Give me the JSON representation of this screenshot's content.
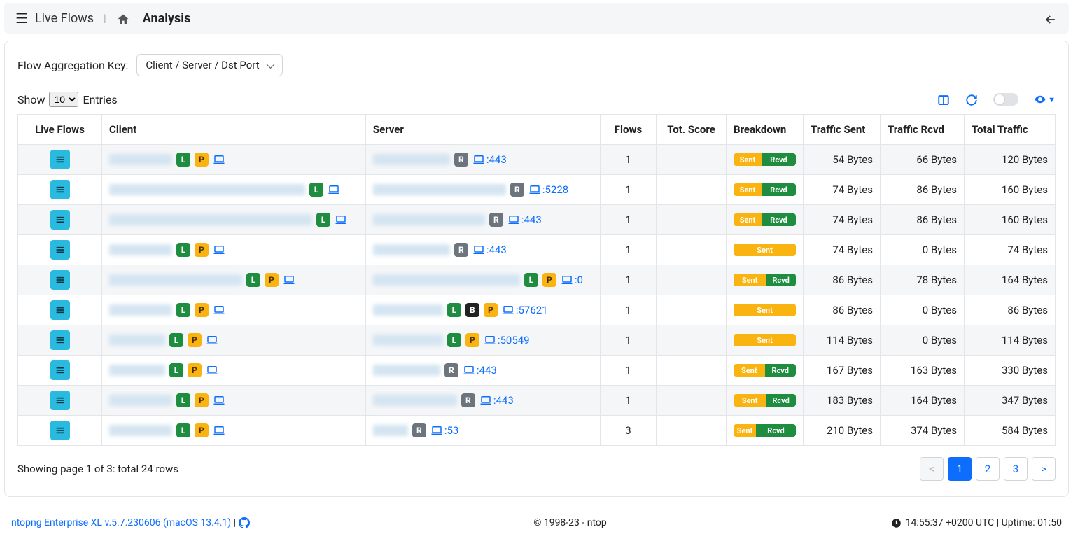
{
  "header": {
    "page_title": "Live Flows",
    "current_section": "Analysis"
  },
  "filter": {
    "label": "Flow Aggregation Key:",
    "selected": "Client / Server / Dst Port"
  },
  "table_controls": {
    "show_label": "Show",
    "entries_label": "Entries",
    "page_size": "10"
  },
  "columns": {
    "live": "Live Flows",
    "client": "Client",
    "server": "Server",
    "flows": "Flows",
    "score": "Tot. Score",
    "breakdown": "Breakdown",
    "sent": "Traffic Sent",
    "rcvd": "Traffic Rcvd",
    "total": "Total Traffic"
  },
  "breakdown_labels": {
    "sent": "Sent",
    "rcvd": "Rcvd"
  },
  "rows": [
    {
      "client_w": 90,
      "client_badges": [
        "L",
        "P"
      ],
      "server_w": 110,
      "server_badges": [
        "R"
      ],
      "port": "443",
      "flows": "1",
      "sent_pct": 45,
      "rcvd_pct": 55,
      "sent": "54 Bytes",
      "rcvd": "66 Bytes",
      "total": "120 Bytes"
    },
    {
      "client_w": 280,
      "client_badges": [
        "L"
      ],
      "server_w": 190,
      "server_badges": [
        "R"
      ],
      "port": "5228",
      "flows": "1",
      "sent_pct": 45,
      "rcvd_pct": 55,
      "sent": "74 Bytes",
      "rcvd": "86 Bytes",
      "total": "160 Bytes"
    },
    {
      "client_w": 290,
      "client_badges": [
        "L"
      ],
      "server_w": 160,
      "server_badges": [
        "R"
      ],
      "port": "443",
      "flows": "1",
      "sent_pct": 45,
      "rcvd_pct": 55,
      "sent": "74 Bytes",
      "rcvd": "86 Bytes",
      "total": "160 Bytes"
    },
    {
      "client_w": 90,
      "client_badges": [
        "L",
        "P"
      ],
      "server_w": 110,
      "server_badges": [
        "R"
      ],
      "port": "443",
      "flows": "1",
      "sent_pct": 100,
      "rcvd_pct": 0,
      "sent": "74 Bytes",
      "rcvd": "0 Bytes",
      "total": "74 Bytes"
    },
    {
      "client_w": 190,
      "client_badges": [
        "L",
        "P"
      ],
      "server_w": 210,
      "server_badges": [
        "L",
        "P"
      ],
      "port": "0",
      "flows": "1",
      "sent_pct": 52,
      "rcvd_pct": 48,
      "sent": "86 Bytes",
      "rcvd": "78 Bytes",
      "total": "164 Bytes"
    },
    {
      "client_w": 90,
      "client_badges": [
        "L",
        "P"
      ],
      "server_w": 100,
      "server_badges": [
        "L",
        "B",
        "P"
      ],
      "port": "57621",
      "flows": "1",
      "sent_pct": 100,
      "rcvd_pct": 0,
      "sent": "86 Bytes",
      "rcvd": "0 Bytes",
      "total": "86 Bytes"
    },
    {
      "client_w": 80,
      "client_badges": [
        "L",
        "P"
      ],
      "server_w": 100,
      "server_badges": [
        "L",
        "P"
      ],
      "port": "50549",
      "flows": "1",
      "sent_pct": 100,
      "rcvd_pct": 0,
      "sent": "114 Bytes",
      "rcvd": "0 Bytes",
      "total": "114 Bytes"
    },
    {
      "client_w": 80,
      "client_badges": [
        "L",
        "P"
      ],
      "server_w": 96,
      "server_badges": [
        "R"
      ],
      "port": "443",
      "flows": "1",
      "sent_pct": 50,
      "rcvd_pct": 50,
      "sent": "167 Bytes",
      "rcvd": "163 Bytes",
      "total": "330 Bytes"
    },
    {
      "client_w": 90,
      "client_badges": [
        "L",
        "P"
      ],
      "server_w": 120,
      "server_badges": [
        "R"
      ],
      "port": "443",
      "flows": "1",
      "sent_pct": 52,
      "rcvd_pct": 48,
      "sent": "183 Bytes",
      "rcvd": "164 Bytes",
      "total": "347 Bytes"
    },
    {
      "client_w": 90,
      "client_badges": [
        "L",
        "P"
      ],
      "server_w": 50,
      "server_badges": [
        "R"
      ],
      "port": "53",
      "flows": "3",
      "sent_pct": 36,
      "rcvd_pct": 64,
      "sent": "210 Bytes",
      "rcvd": "374 Bytes",
      "total": "584 Bytes"
    }
  ],
  "paging": {
    "summary": "Showing page 1 of 3: total 24 rows",
    "prev": "<",
    "next": ">",
    "pages": [
      "1",
      "2",
      "3"
    ],
    "active": "1"
  },
  "footer": {
    "version": "ntopng Enterprise XL v.5.7.230606 (macOS 13.4.1)",
    "copyright": "© 1998-23 - ntop",
    "time": "14:55:37 +0200 UTC | Uptime: 01:50"
  }
}
